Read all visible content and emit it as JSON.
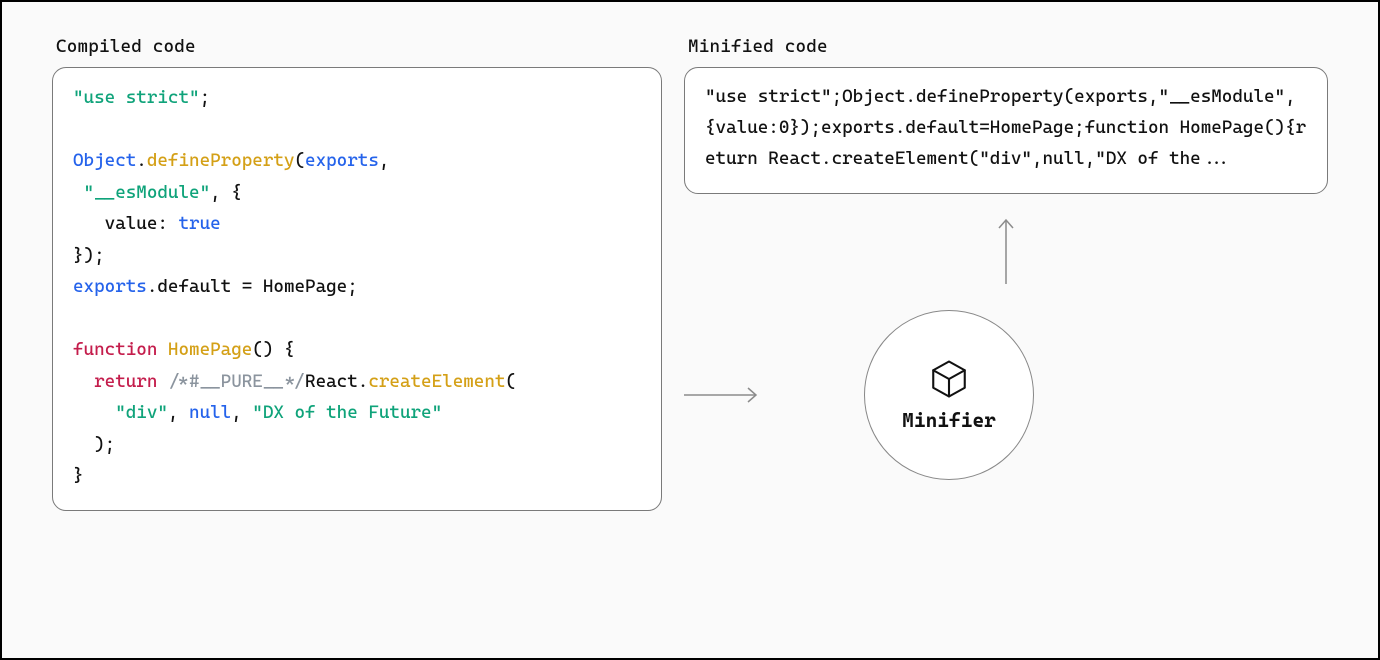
{
  "layout": {
    "left_title": "Compiled code",
    "right_title": "Minified code",
    "node_label": "Minifier"
  },
  "compiled_code": {
    "l1_str": "\"use strict\"",
    "l1_rest": ";",
    "blank1": "",
    "l3_obj": "Object",
    "l3_dot": ".",
    "l3_fn": "defineProperty",
    "l3_open": "(",
    "l3_arg": "exports",
    "l3_end": ",",
    "l4_pre": " ",
    "l4_str": "\"__esModule\"",
    "l4_rest": ", {",
    "l5_pre": "   value: ",
    "l5_bool": "true",
    "l6": "});",
    "l7_obj": "exports",
    "l7_rest": ".default = HomePage;",
    "blank2": "",
    "l9_kw": "function",
    "l9_sp": " ",
    "l9_name": "HomePage",
    "l9_rest": "() {",
    "l10_pre": "  ",
    "l10_kw": "return",
    "l10_sp": " ",
    "l10_comm": "/*#__PURE__*/",
    "l10_r": "React.",
    "l10_fn": "createElement",
    "l10_open": "(",
    "l11_pre": "    ",
    "l11_s1": "\"div\"",
    "l11_c1": ", ",
    "l11_null": "null",
    "l11_c2": ", ",
    "l11_s2": "\"DX of the Future\"",
    "l12": "  );",
    "l13": "}"
  },
  "minified_code": "\"use strict\";Object.defineProperty(exports,\"__esModule\",{value:0});exports.default=HomePage;function HomePage(){return React.createElement(\"div\",null,\"DX of the..."
}
